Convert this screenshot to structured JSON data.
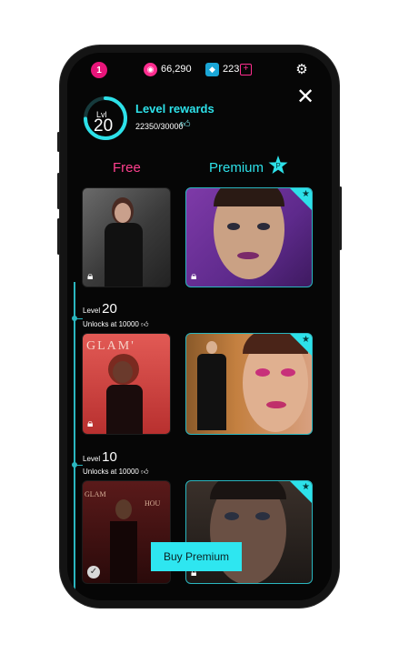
{
  "status": {
    "notifications": "1",
    "coins": "66,290",
    "gems": "223"
  },
  "header": {
    "level_prefix": "Lvl",
    "level": "20",
    "title": "Level rewards",
    "xp": "22350/30000",
    "progress_fraction": 0.745
  },
  "tabs": {
    "free": "Free",
    "premium": "Premium"
  },
  "rows": [
    {
      "level_prefix": "Level",
      "level": "20",
      "unlock_label": "Unlocks at",
      "unlock_value": "10000"
    },
    {
      "level_prefix": "Level",
      "level": "10",
      "unlock_label": "Unlocks at",
      "unlock_value": "10000"
    }
  ],
  "card_text": {
    "glam": "GLAM'",
    "glam_small": "GLAM",
    "house": "HOU"
  },
  "cta": {
    "label": "Buy Premium"
  },
  "colors": {
    "accent_cyan": "#2de1e9",
    "accent_pink": "#ff3f8e",
    "background": "#060606"
  }
}
